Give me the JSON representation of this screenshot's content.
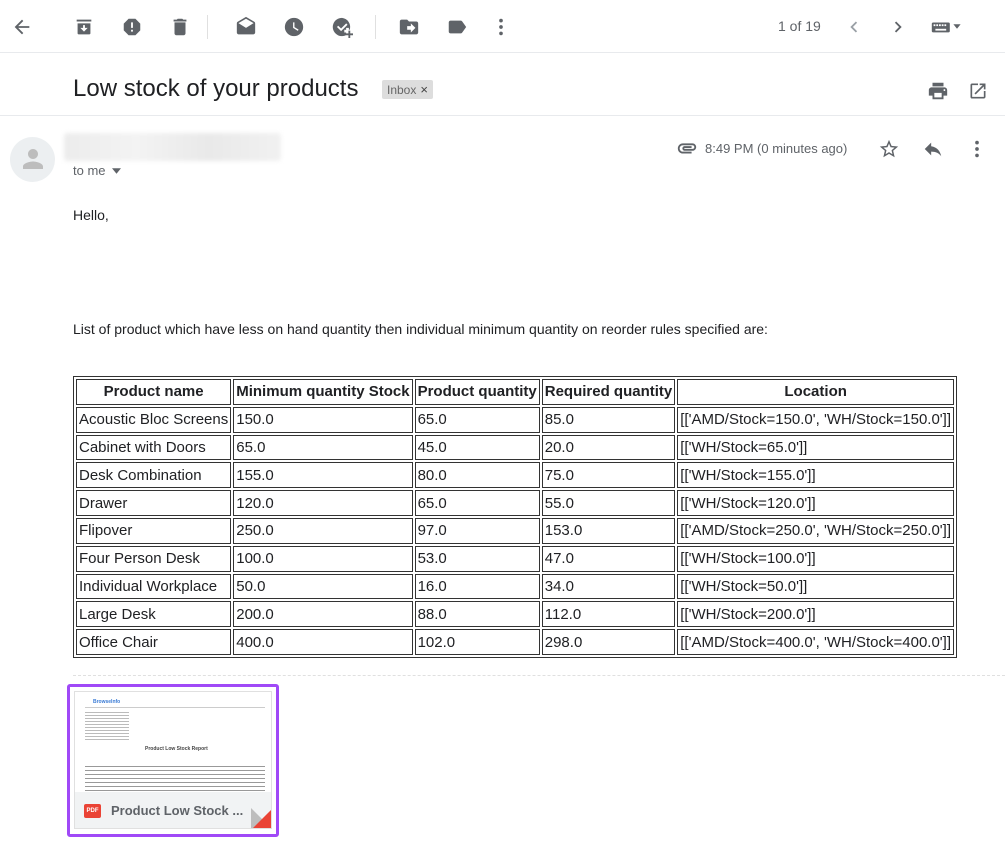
{
  "toolbar": {
    "pager": "1 of 19",
    "icons": [
      "back-arrow-icon",
      "archive-icon",
      "report-spam-icon",
      "delete-icon",
      "mark-unread-icon",
      "snooze-icon",
      "add-to-tasks-icon",
      "move-to-icon",
      "label-icon",
      "more-vert-icon",
      "chevron-left-icon",
      "chevron-right-icon",
      "keyboard-icon"
    ]
  },
  "email": {
    "subject": "Low stock of your products",
    "label": "Inbox",
    "label_close": "×",
    "recipient": "to me",
    "timestamp": "8:49 PM (0 minutes ago)",
    "greeting": "Hello,",
    "intro": "List of product which have less on hand quantity then individual minimum quantity on reorder rules specified are:"
  },
  "table": {
    "headers": [
      "Product name",
      "Minimum quantity Stock",
      "Product quantity",
      "Required quantity",
      "Location"
    ],
    "rows": [
      [
        "Acoustic Bloc Screens",
        "150.0",
        "65.0",
        "85.0",
        "[['AMD/Stock=150.0', 'WH/Stock=150.0']]"
      ],
      [
        "Cabinet with Doors",
        "65.0",
        "45.0",
        "20.0",
        "[['WH/Stock=65.0']]"
      ],
      [
        "Desk Combination",
        "155.0",
        "80.0",
        "75.0",
        "[['WH/Stock=155.0']]"
      ],
      [
        "Drawer",
        "120.0",
        "65.0",
        "55.0",
        "[['WH/Stock=120.0']]"
      ],
      [
        "Flipover",
        "250.0",
        "97.0",
        "153.0",
        "[['AMD/Stock=250.0', 'WH/Stock=250.0']]"
      ],
      [
        "Four Person Desk",
        "100.0",
        "53.0",
        "47.0",
        "[['WH/Stock=100.0']]"
      ],
      [
        "Individual Workplace",
        "50.0",
        "16.0",
        "34.0",
        "[['WH/Stock=50.0']]"
      ],
      [
        "Large Desk",
        "200.0",
        "88.0",
        "112.0",
        "[['WH/Stock=200.0']]"
      ],
      [
        "Office Chair",
        "400.0",
        "102.0",
        "298.0",
        "[['AMD/Stock=400.0', 'WH/Stock=400.0']]"
      ]
    ]
  },
  "attachment": {
    "name": "Product Low Stock ...",
    "type_badge": "PDF",
    "preview_title": "Product Low Stock Report",
    "preview_logo": "BrowseInfo"
  },
  "colors": {
    "attachment_border": "#a049f7",
    "pdf_red": "#ea4335",
    "icon_gray": "#5f6368"
  }
}
